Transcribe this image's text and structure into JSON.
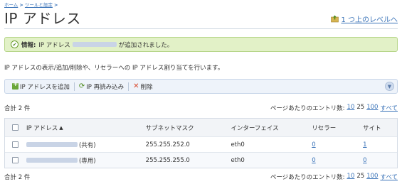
{
  "breadcrumb": [
    "ホーム",
    "ツールと設定"
  ],
  "breadcrumb_sep": ">",
  "page_title": "IP アドレス",
  "up_link": "1 つ上のレベルへ",
  "info": {
    "label": "情報:",
    "prefix": "IP アドレス",
    "suffix": "が追加されました。"
  },
  "description": "IP アドレスの表示/追加/削除や、リセラーへの IP アドレス割り当てを行います。",
  "toolbar": {
    "add_label": "IP アドレスを追加",
    "reload_label": "IP 再読み込み",
    "delete_label": "削除"
  },
  "total_label": "合計 2 件",
  "pager": {
    "label": "ページあたりのエントリ数:",
    "options": [
      "10",
      "25",
      "100",
      "すべて"
    ],
    "selected": "25"
  },
  "table": {
    "columns": [
      "IP アドレス",
      "サブネットマスク",
      "インターフェイス",
      "リセラー",
      "サイト"
    ],
    "rows": [
      {
        "ip_type": "(共有)",
        "mask": "255.255.252.0",
        "iface": "eth0",
        "resellers": "0",
        "sites": "1"
      },
      {
        "ip_type": "(専用)",
        "mask": "255.255.255.0",
        "iface": "eth0",
        "resellers": "0",
        "sites": "0"
      }
    ]
  },
  "icons": {
    "up_level": "folder-up-icon",
    "info": "check-icon",
    "add": "add-ip-icon",
    "reload": "reload-icon",
    "delete": "delete-icon",
    "collapse": "chevron-down-icon",
    "sort": "sort-ascending-icon"
  },
  "colors": {
    "link": "#3a73b8",
    "info_bg": "#e2f1c7",
    "toolbar_bg": "#eef3fa"
  }
}
